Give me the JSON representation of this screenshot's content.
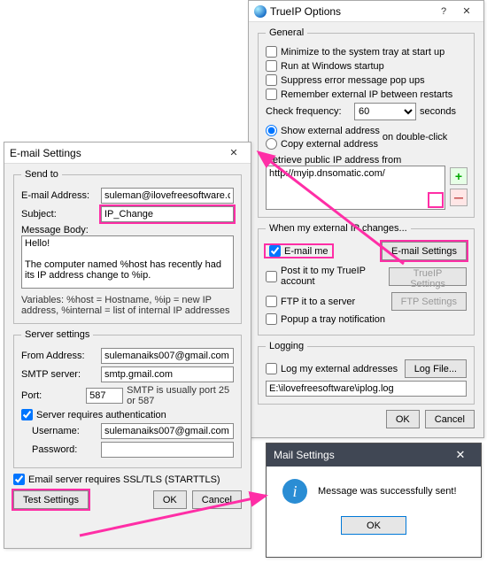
{
  "email_win": {
    "title": "E-mail Settings",
    "sendto": {
      "legend": "Send to",
      "addr_label": "E-mail Address:",
      "addr": "suleman@ilovefreesoftware.com",
      "subj_label": "Subject:",
      "subj": "IP_Change",
      "body_label": "Message Body:",
      "body": "Hello!\n\nThe computer named %host has recently had its IP address change to %ip.",
      "vars": "Variables:  %host = Hostname,  %ip = new IP address,  %internal = list of internal IP addresses"
    },
    "server": {
      "legend": "Server settings",
      "from_label": "From Address:",
      "from": "sulemanaiks007@gmail.com",
      "smtp_label": "SMTP server:",
      "smtp": "smtp.gmail.com",
      "port_label": "Port:",
      "port": "587",
      "port_hint": "SMTP is usually port 25 or 587",
      "auth_chk": "Server requires authentication",
      "user_label": "Username:",
      "user": "sulemanaiks007@gmail.com",
      "pass_label": "Password:"
    },
    "ssl_chk": "Email server requires SSL/TLS (STARTTLS)",
    "btn_test": "Test Settings",
    "btn_ok": "OK",
    "btn_cancel": "Cancel"
  },
  "options_win": {
    "title": "TrueIP Options",
    "general": {
      "legend": "General",
      "min_tray": "Minimize to the system tray at start up",
      "win_start": "Run at Windows startup",
      "suppress": "Suppress error message pop ups",
      "remember": "Remember external IP between restarts",
      "freq_label": "Check frequency:",
      "freq_val": "60",
      "freq_unit": "seconds",
      "radio_show": "Show external address",
      "radio_copy": "Copy external address",
      "dbl": "on double-click",
      "retrieve_label": "Retrieve public IP address from",
      "ip_src": "http://myip.dnsomatic.com/"
    },
    "changes": {
      "legend": "When my external IP changes...",
      "email_me": "E-mail me",
      "email_set_btn": "E-mail Settings",
      "post_it": "Post it to my TrueIP account",
      "trueip_btn": "TrueIP Settings",
      "ftp_it": "FTP it to a server",
      "ftp_btn": "FTP Settings",
      "popup_tray": "Popup a tray notification"
    },
    "logging": {
      "legend": "Logging",
      "log_chk": "Log my external addresses",
      "log_btn": "Log File...",
      "log_path": "E:\\ilovefreesoftware\\iplog.log"
    },
    "btn_ok": "OK",
    "btn_cancel": "Cancel"
  },
  "mail_dlg": {
    "title": "Mail Settings",
    "msg": "Message was successfully sent!",
    "btn_ok": "OK"
  }
}
